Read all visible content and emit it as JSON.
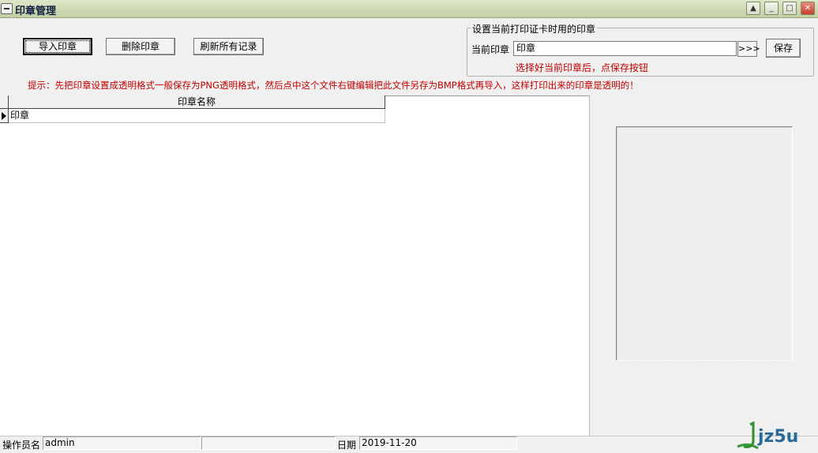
{
  "window": {
    "title": "印章管理",
    "min_label": "_",
    "max_label": "□",
    "close_label": "✕",
    "help_label": "▲"
  },
  "toolbar": {
    "import_label": "导入印章",
    "delete_label": "删除印章",
    "refresh_label": "刷新所有记录"
  },
  "group": {
    "legend": "设置当前打印证卡时用的印章",
    "current_label": "当前印章",
    "current_value": "印章",
    "browse_label": ">>>",
    "save_label": "保存",
    "hint": "选择好当前印章后，点保存按钮"
  },
  "tip": "提示：先把印章设置成透明格式一般保存为PNG透明格式，然后点中这个文件右键编辑把此文件另存为BMP格式再导入，这样打印出来的印章是透明的！",
  "grid": {
    "columns": [
      "印章名称"
    ],
    "rows": [
      [
        "印章"
      ]
    ]
  },
  "status": {
    "operator_label": "操作员名",
    "operator_value": "admin",
    "date_label": "日期",
    "date_value": "2019-11-20"
  },
  "logo": {
    "text": "jz5u"
  },
  "colors": {
    "red_text": "#c00000",
    "titlebar": "#c3d0a2"
  }
}
